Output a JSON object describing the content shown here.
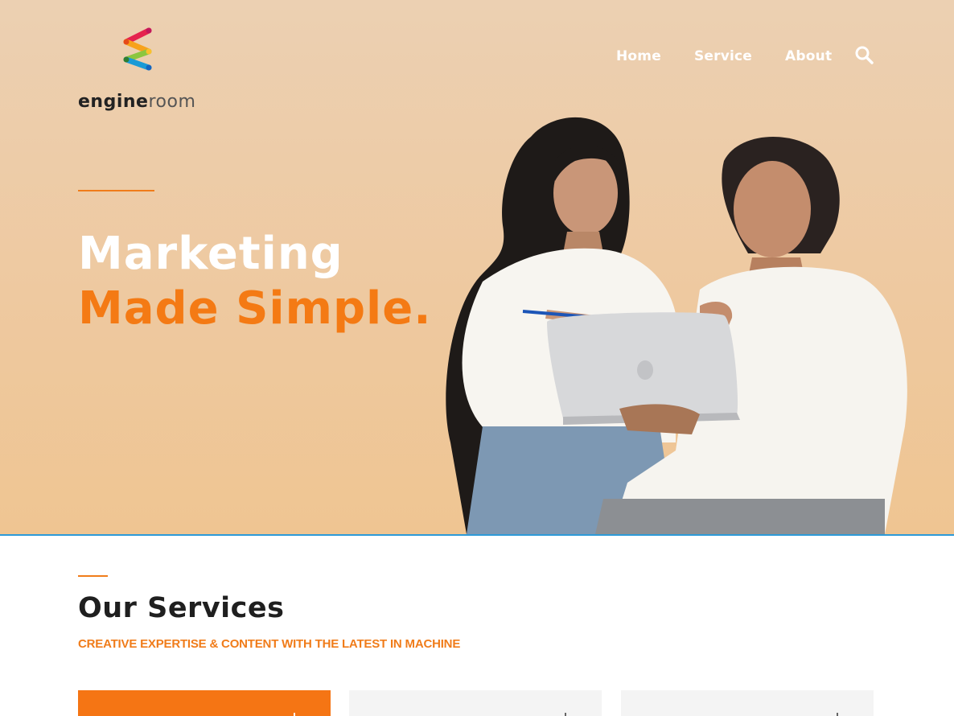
{
  "brand": {
    "name_bold": "engine",
    "name_light": "room"
  },
  "nav": {
    "items": [
      {
        "label": "Home"
      },
      {
        "label": "Service"
      },
      {
        "label": "About"
      }
    ],
    "search_icon": "search-icon"
  },
  "hero": {
    "line1": "Marketing",
    "line2": "Made Simple.",
    "accent_color": "#f47a14"
  },
  "services": {
    "title": "Our Services",
    "subtitle": "CREATIVE EXPERTISE & CONTENT WITH THE LATEST IN MACHINE",
    "cards": [
      {
        "active": true
      },
      {
        "active": false
      },
      {
        "active": false
      }
    ]
  },
  "colors": {
    "orange": "#f57514",
    "hero_bg": "#edcaa2",
    "divider_blue": "#2d9ad8",
    "text_dark": "#1f1f1f"
  }
}
